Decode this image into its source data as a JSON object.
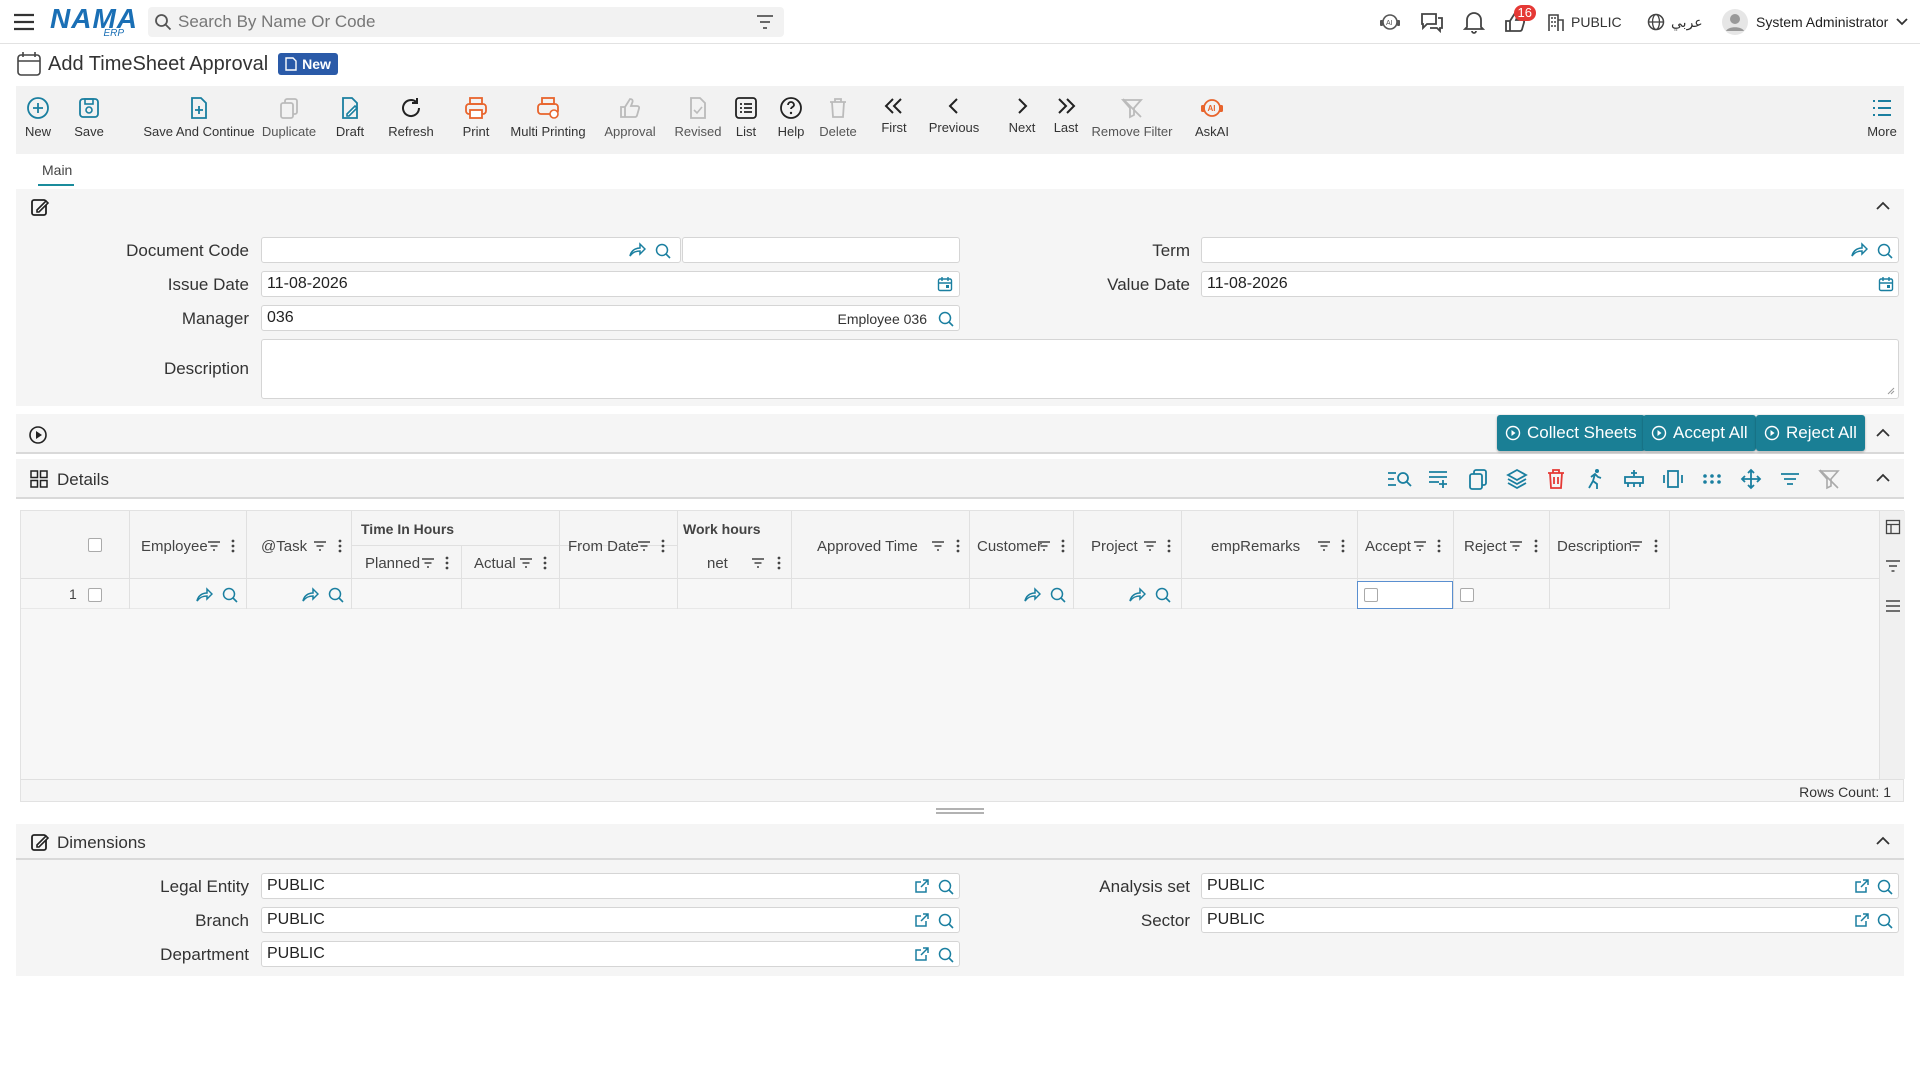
{
  "header": {
    "logo_text": "NAMA",
    "logo_sub": "ERP",
    "search_placeholder": "Search By Name Or Code",
    "notification_count": "16",
    "company": "PUBLIC",
    "language": "عربي",
    "user": "System Administrator"
  },
  "page": {
    "title": "Add TimeSheet Approval",
    "status_badge": "New"
  },
  "toolbar": {
    "new": "New",
    "save": "Save",
    "save_continue": "Save And Continue",
    "duplicate": "Duplicate",
    "draft": "Draft",
    "refresh": "Refresh",
    "print": "Print",
    "multi_printing": "Multi Printing",
    "approval": "Approval",
    "revised": "Revised",
    "list": "List",
    "help": "Help",
    "delete": "Delete",
    "first": "First",
    "previous": "Previous",
    "next": "Next",
    "last": "Last",
    "remove_filter": "Remove Filter",
    "askai": "AskAI",
    "more": "More"
  },
  "tabs": {
    "main": "Main"
  },
  "form": {
    "document_code_label": "Document Code",
    "document_code_value": "",
    "term_label": "Term",
    "term_value": "",
    "issue_date_label": "Issue Date",
    "issue_date_value": "11-08-2026",
    "value_date_label": "Value Date",
    "value_date_value": "11-08-2026",
    "manager_label": "Manager",
    "manager_code": "036",
    "manager_name": "Employee 036",
    "description_label": "Description",
    "description_value": ""
  },
  "actions": {
    "collect_sheets": "Collect Sheets",
    "accept_all": "Accept All",
    "reject_all": "Reject All"
  },
  "details": {
    "title": "Details",
    "columns": {
      "employee": "Employee",
      "task": "@Task",
      "time_in_hours": "Time In Hours",
      "planned": "Planned",
      "actual": "Actual",
      "from_date": "From Date",
      "work_hours": "Work hours",
      "net": "net",
      "approved_time": "Approved Time",
      "customer": "Customer",
      "project": "Project",
      "emp_remarks": "empRemarks",
      "accept": "Accept",
      "reject": "Reject",
      "description": "Description"
    },
    "rows": [
      {
        "num": "1"
      }
    ],
    "rows_count": "Rows Count: 1"
  },
  "dimensions": {
    "title": "Dimensions",
    "legal_entity_label": "Legal Entity",
    "legal_entity_value": "PUBLIC",
    "analysis_set_label": "Analysis set",
    "analysis_set_value": "PUBLIC",
    "branch_label": "Branch",
    "branch_value": "PUBLIC",
    "sector_label": "Sector",
    "sector_value": "PUBLIC",
    "department_label": "Department",
    "department_value": "PUBLIC"
  },
  "colors": {
    "primary": "#1a7f95",
    "brand": "#1a6fb5",
    "accent_orange": "#e8642c",
    "badge_red": "#e53935",
    "new_badge": "#2a5aa8"
  }
}
